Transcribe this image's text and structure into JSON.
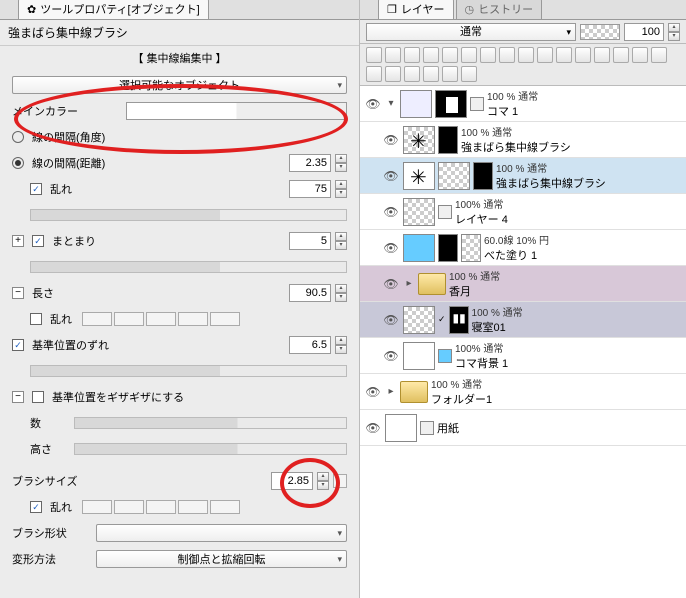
{
  "left": {
    "tab": "ツールプロパティ[オブジェクト]",
    "title": "強まばら集中線ブラシ",
    "edit_mode": "【 集中線編集中 】",
    "selectable": "選択可能なオブジェクト",
    "main_color": "メインカラー",
    "gap_angle": "線の間隔(角度)",
    "gap_dist": "線の間隔(距離)",
    "gap_dist_val": "2.35",
    "midare": "乱れ",
    "midare_val": "75",
    "matomari": "まとまり",
    "matomari_val": "5",
    "length": "長さ",
    "length_val": "90.5",
    "midare2": "乱れ",
    "basepos": "基準位置のずれ",
    "basepos_val": "6.5",
    "jaggy": "基準位置をギザギザにする",
    "jaggy_num": "数",
    "jaggy_height": "高さ",
    "brush_size": "ブラシサイズ",
    "brush_size_val": "2.85",
    "midare3": "乱れ",
    "brush_shape": "ブラシ形状",
    "deform": "変形方法",
    "deform_val": "制御点と拡縮回転"
  },
  "right": {
    "tab_layers": "レイヤー",
    "tab_history": "ヒストリー",
    "blend": "通常",
    "opacity": "100",
    "layers": [
      {
        "mode": "100 % 通常",
        "name": "コマ 1"
      },
      {
        "mode": "100 % 通常",
        "name": "強まばら集中線ブラシ"
      },
      {
        "mode": "100 % 通常",
        "name": "強まばら集中線ブラシ"
      },
      {
        "mode": "100% 通常",
        "name": "レイヤー 4"
      },
      {
        "mode": "60.0線 10% 円",
        "name": "べた塗り 1"
      },
      {
        "mode": "100 % 通常",
        "name": "香月"
      },
      {
        "mode": "100 % 通常",
        "name": "寝室01"
      },
      {
        "mode": "100% 通常",
        "name": "コマ背景 1"
      },
      {
        "mode": "100 % 通常",
        "name": "フォルダー1"
      },
      {
        "mode": "",
        "name": "用紙"
      }
    ]
  }
}
